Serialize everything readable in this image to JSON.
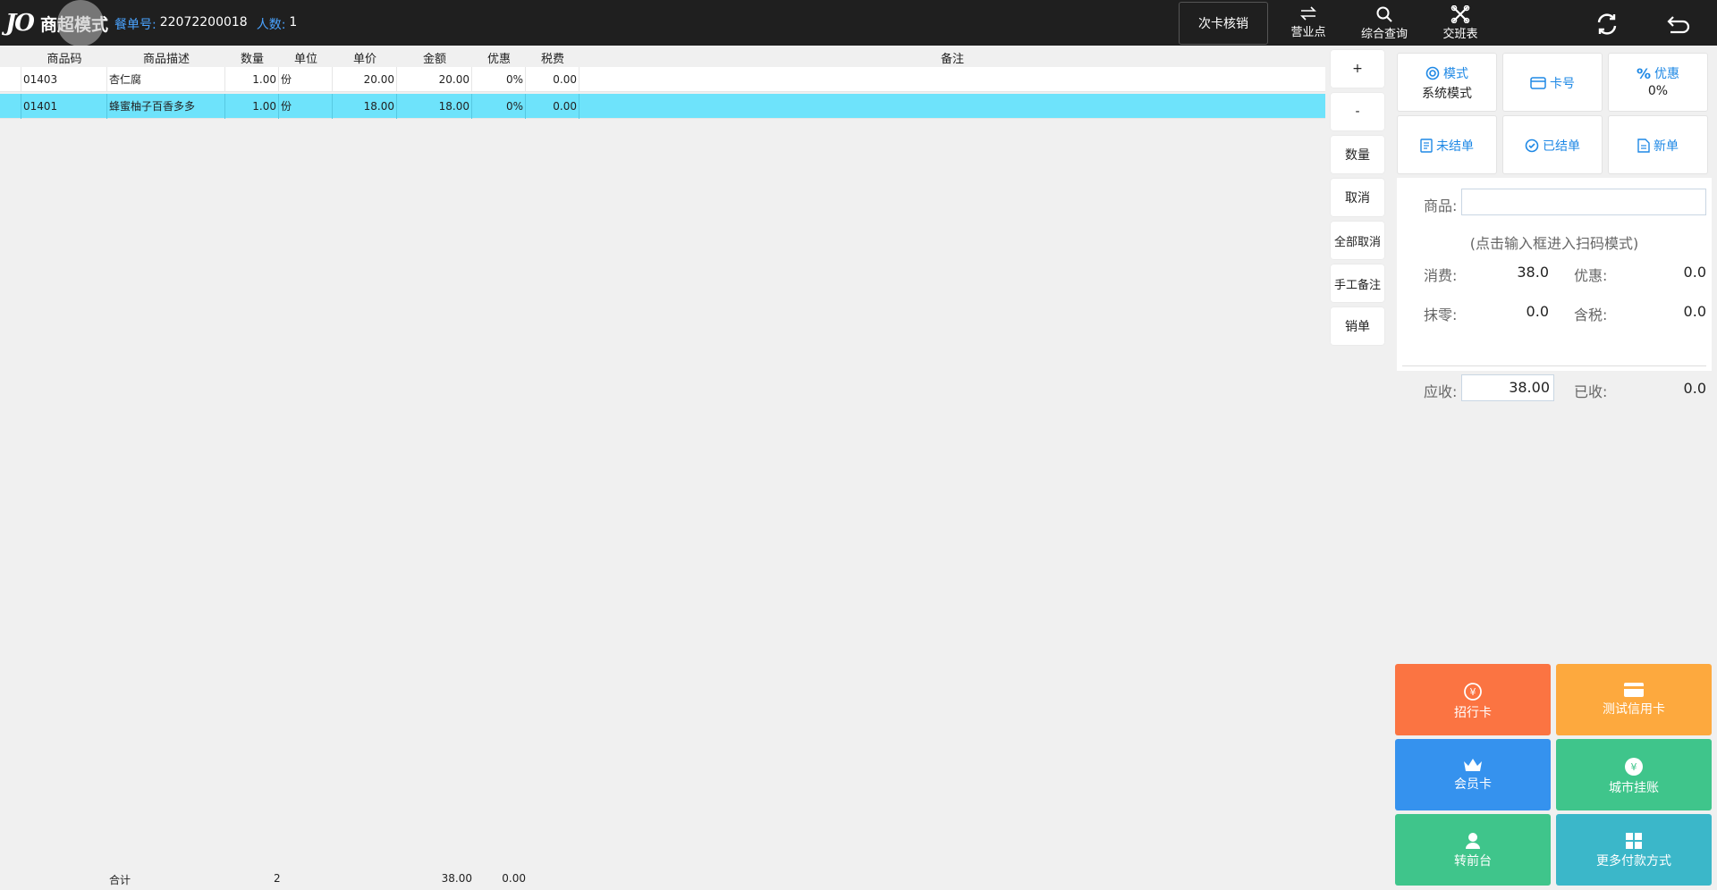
{
  "header": {
    "logo_mark": "JO",
    "mode_title": "商超模式",
    "order_label": "餐单号:",
    "order_no": "22072200018",
    "people_label": "人数:",
    "people_count": "1",
    "card_verify": "次卡核销",
    "buttons": [
      {
        "label": "营业点",
        "icon": "swap-icon"
      },
      {
        "label": "综合查询",
        "icon": "search-icon"
      },
      {
        "label": "交班表",
        "icon": "crossed-tools-icon"
      }
    ],
    "refresh_icon": "refresh-icon",
    "back_icon": "back-icon"
  },
  "table": {
    "columns": [
      "商品码",
      "商品描述",
      "数量",
      "单位",
      "单价",
      "金额",
      "优惠",
      "税费",
      "备注"
    ],
    "rows": [
      {
        "code": "01403",
        "desc": "杏仁腐",
        "qty": "1.00",
        "unit": "份",
        "price": "20.00",
        "amount": "20.00",
        "discount": "0%",
        "tax": "0.00",
        "note": "",
        "selected": false
      },
      {
        "code": "01401",
        "desc": "蜂蜜柚子百香多多",
        "qty": "1.00",
        "unit": "份",
        "price": "18.00",
        "amount": "18.00",
        "discount": "0%",
        "tax": "0.00",
        "note": "",
        "selected": true
      }
    ],
    "footer": {
      "label": "合计",
      "count": "2",
      "amount": "38.00",
      "discount": "0.00"
    }
  },
  "side_buttons": [
    "+",
    "-",
    "数量",
    "取消",
    "全部取消",
    "手工备注",
    "销单"
  ],
  "panel": {
    "tiles": [
      {
        "label": "模式",
        "value": "系统模式",
        "icon": "circle-icon"
      },
      {
        "label": "卡号",
        "value": "",
        "icon": "card-icon"
      },
      {
        "label": "优惠",
        "value": "0%",
        "icon": "percent-icon"
      },
      {
        "label": "未结单",
        "value": "",
        "icon": "doc-icon"
      },
      {
        "label": "已结单",
        "value": "",
        "icon": "settled-icon"
      },
      {
        "label": "新单",
        "value": "",
        "icon": "new-doc-icon"
      }
    ],
    "product_label": "商品:",
    "product_value": "",
    "scan_hint": "(点击输入框进入扫码模式)",
    "consume_label": "消费:",
    "consume_value": "38.0",
    "discount_label": "优惠:",
    "discount_value": "0.0",
    "round_label": "抹零:",
    "round_value": "0.0",
    "tax_label": "含税:",
    "tax_value": "0.0",
    "due_label": "应收:",
    "due_value": "38.00",
    "paid_label": "已收:",
    "paid_value": "0.0"
  },
  "payments": [
    {
      "label": "招行卡",
      "icon": "yen-coin-icon",
      "color": "#fb7442"
    },
    {
      "label": "测试信用卡",
      "icon": "credit-card-icon",
      "color": "#fda93e"
    },
    {
      "label": "会员卡",
      "icon": "crown-icon",
      "color": "#3592ee"
    },
    {
      "label": "城市挂账",
      "icon": "yen-circle-icon",
      "color": "#3fc58b"
    },
    {
      "label": "转前台",
      "icon": "person-icon",
      "color": "#3fc58b"
    },
    {
      "label": "更多付款方式",
      "icon": "grid-icon",
      "color": "#3bb7c9"
    }
  ]
}
